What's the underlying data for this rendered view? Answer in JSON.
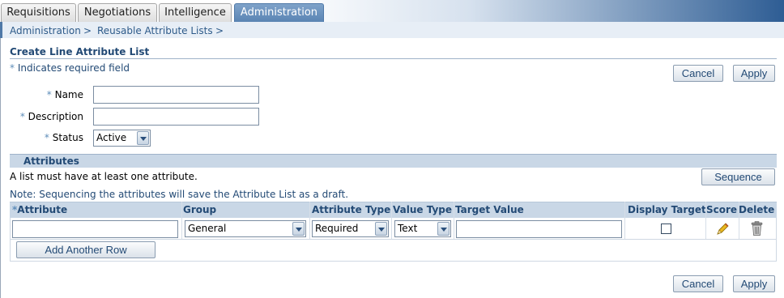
{
  "tabs": [
    {
      "label": "Requisitions",
      "active": false
    },
    {
      "label": "Negotiations",
      "active": false
    },
    {
      "label": "Intelligence",
      "active": false
    },
    {
      "label": "Administration",
      "active": true
    }
  ],
  "breadcrumb": {
    "items": [
      "Administration",
      "Reusable Attribute Lists"
    ],
    "separator": ">"
  },
  "page": {
    "title": "Create Line Attribute List",
    "required_note_star": "*",
    "required_note": "Indicates required field"
  },
  "buttons": {
    "cancel": "Cancel",
    "apply": "Apply",
    "sequence": "Sequence",
    "add_row": "Add Another Row"
  },
  "form": {
    "name_label": "Name",
    "name_value": "",
    "description_label": "Description",
    "description_value": "",
    "status_label": "Status",
    "status_value": "Active",
    "required_star": "*"
  },
  "attributes": {
    "section_title": "Attributes",
    "min_note": "A list must have at least one attribute.",
    "sequence_note": "Note: Sequencing the attributes will save the Attribute List as a draft.",
    "columns": {
      "attribute": "Attribute",
      "group": "Group",
      "attribute_type": "Attribute Type",
      "value_type": "Value Type",
      "target_value": "Target Value",
      "display_target": "Display Target",
      "score": "Score",
      "delete": "Delete"
    },
    "rows": [
      {
        "attribute": "",
        "group": "General",
        "attribute_type": "Required",
        "value_type": "Text",
        "target_value": "",
        "display_target": false
      }
    ]
  },
  "colors": {
    "accent": "#234a75",
    "active_tab": "#5a84b3",
    "section_header": "#c9d7e6"
  },
  "icons": {
    "score": "pencil-icon",
    "delete": "trash-icon"
  }
}
